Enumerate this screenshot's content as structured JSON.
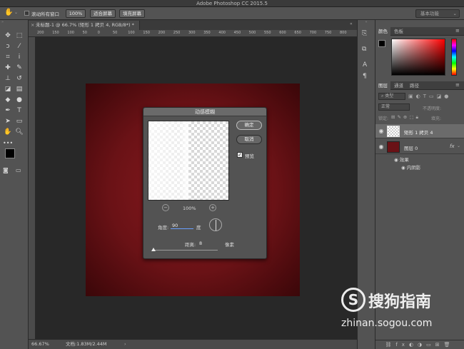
{
  "app": {
    "window_title": "Adobe Photoshop CC 2015.5"
  },
  "options_bar": {
    "scroll_all_windows": "滚动所有窗口",
    "zoom_100": "100%",
    "fit_screen": "适合屏幕",
    "fill_screen": "填充屏幕",
    "workspace": "基本功能"
  },
  "document": {
    "tab_title": "未标题-1 @ 66.7% (矩形 1 拷贝 4, RGB/8*) *",
    "ruler_ticks": [
      "200",
      "150",
      "100",
      "50",
      "0",
      "50",
      "100",
      "150",
      "200",
      "250",
      "300",
      "350",
      "400",
      "450",
      "500",
      "550",
      "600",
      "650",
      "700",
      "750",
      "800"
    ],
    "zoom_status": "66.67%",
    "doc_size": "文档:1.83M/2.44M"
  },
  "dialog": {
    "title": "动感模糊",
    "ok": "确定",
    "cancel": "取消",
    "preview_label": "预览",
    "preview_checked": true,
    "zoom_level": "100%",
    "angle_label": "角度:",
    "angle_value": "90",
    "angle_unit": "度",
    "distance_label": "距离:",
    "distance_value": "8",
    "distance_unit": "像素",
    "distance_slider_fraction": 0.02
  },
  "color_panel": {
    "tabs": [
      "颜色",
      "色板"
    ],
    "active_tab": "颜色",
    "foreground": "#000000",
    "background": "#ffffff",
    "hue_color": "#ff0000"
  },
  "layers_panel": {
    "tabs": [
      "图层",
      "通道",
      "路径"
    ],
    "active_tab": "图层",
    "kind_filter": "类型",
    "blend_mode": "正常",
    "opacity_label": "不透明度:",
    "lock_label": "锁定:",
    "fill_label": "填充:",
    "layers": [
      {
        "name": "矩形 1 拷贝 4",
        "selected": true,
        "fx": false,
        "thumb": "transparent"
      },
      {
        "name": "图层 0",
        "selected": false,
        "fx": true,
        "thumb": "#6a1216"
      }
    ],
    "effects_label": "效果",
    "effect_item": "内阴影"
  },
  "watermark": {
    "brand": "搜狗指南",
    "url": "zhinan.sogou.com",
    "logo_letter": "S"
  }
}
